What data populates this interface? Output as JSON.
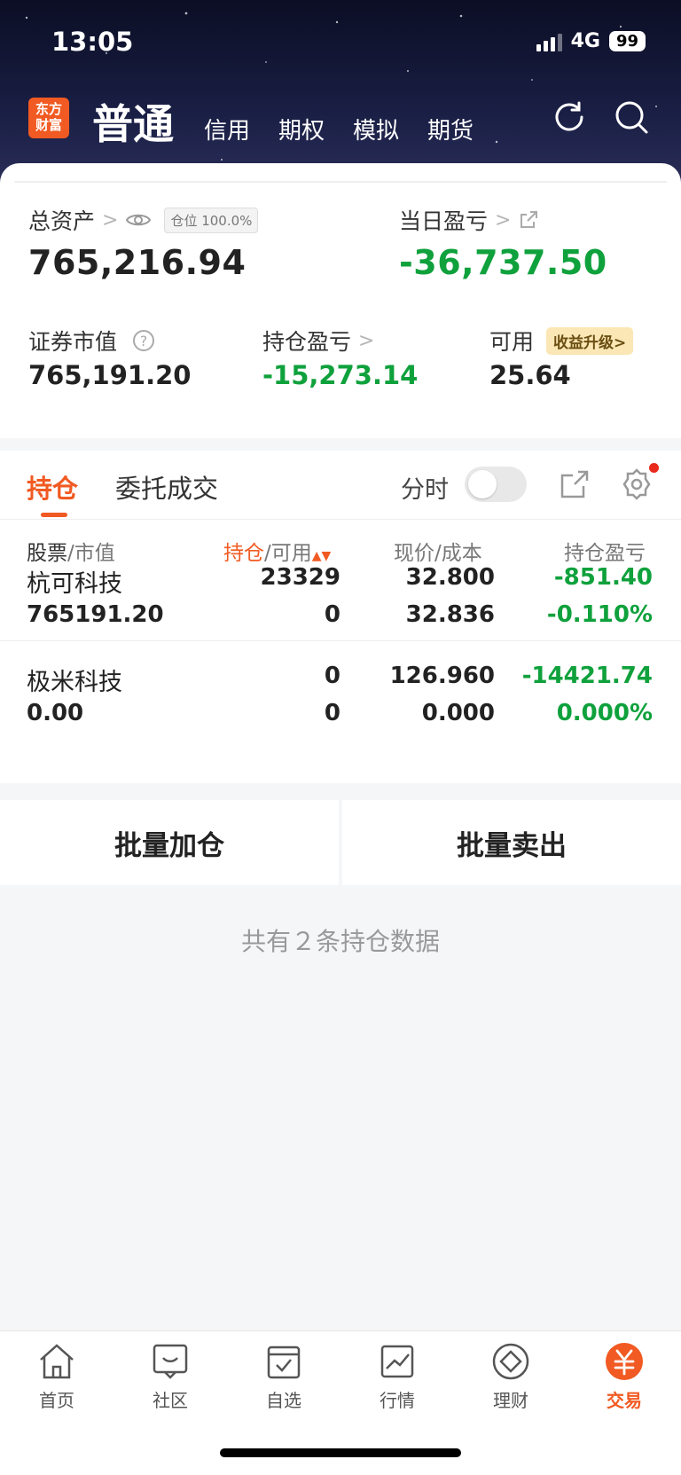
{
  "status": {
    "time": "13:05",
    "network": "4G",
    "battery": "99"
  },
  "header": {
    "logo": "东方财富",
    "tabs": [
      {
        "label": "普通",
        "active": true
      },
      {
        "label": "信用"
      },
      {
        "label": "期权"
      },
      {
        "label": "模拟"
      },
      {
        "label": "期货"
      }
    ],
    "icons": [
      "refresh-icon",
      "search-icon"
    ]
  },
  "summary": {
    "total_assets_label": "总资产",
    "position_badge": "仓位 100.0%",
    "total_assets_value": "765,216.94",
    "daily_pl_label": "当日盈亏",
    "daily_pl_value": "-36,737.50",
    "market_value_label": "证券市值",
    "market_value_value": "765,191.20",
    "holding_pl_label": "持仓盈亏",
    "holding_pl_value": "-15,273.14",
    "available_label": "可用",
    "upgrade_badge": "收益升级>",
    "available_value": "25.64"
  },
  "tabs": {
    "holdings": "持仓",
    "orders": "委托成交",
    "fenshi": "分时"
  },
  "table": {
    "headers": {
      "stock": "股票",
      "market_value": "/市值",
      "holding": "持仓",
      "available": "/可用",
      "price": "现价",
      "cost": "/成本",
      "pl": "持仓盈亏"
    },
    "rows": [
      {
        "name": "杭可科技",
        "market_value": "765191.20",
        "holding": "23329",
        "available": "0",
        "price": "32.800",
        "cost": "32.836",
        "pl": "-851.40",
        "pl_pct": "-0.110%"
      },
      {
        "name": "极米科技",
        "market_value": "0.00",
        "holding": "0",
        "available": "0",
        "price": "126.960",
        "cost": "0.000",
        "pl": "-14421.74",
        "pl_pct": "0.000%"
      }
    ]
  },
  "batch": {
    "add": "批量加仓",
    "sell": "批量卖出"
  },
  "count_text": "共有２条持仓数据",
  "bottom_nav": [
    {
      "label": "首页",
      "icon": "home-icon"
    },
    {
      "label": "社区",
      "icon": "community-icon"
    },
    {
      "label": "自选",
      "icon": "watchlist-icon"
    },
    {
      "label": "行情",
      "icon": "market-icon"
    },
    {
      "label": "理财",
      "icon": "wealth-icon"
    },
    {
      "label": "交易",
      "icon": "trade-icon",
      "active": true
    }
  ],
  "colors": {
    "accent": "#f15a22",
    "loss_green": "#0fa13c"
  }
}
